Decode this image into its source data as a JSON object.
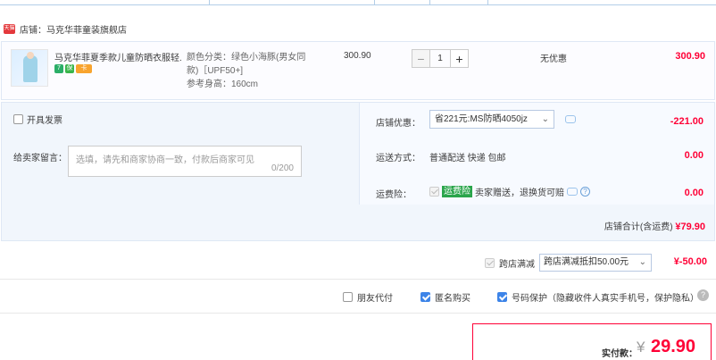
{
  "shop": {
    "badge": "天猫",
    "label": "店铺：",
    "name": "马克华菲童装旗舰店"
  },
  "item": {
    "title": "马克华菲夏季款儿童防晒衣服轻...",
    "badges": [
      "7",
      "保",
      "卡"
    ],
    "sku_color": "颜色分类：绿色小海豚(男女同款)［UPF50+]",
    "sku_height": "参考身高：160cm",
    "unit_price": "300.90",
    "quantity": "1",
    "qty_minus": "−",
    "qty_plus": "+",
    "discount": "无优惠",
    "total": "300.90"
  },
  "invoice": {
    "label": "开具发票"
  },
  "message": {
    "label": "给卖家留言：",
    "placeholder": "选填，请先和商家协商一致，付款后商家可见",
    "counter": "0/200"
  },
  "shop_coupon": {
    "label": "店铺优惠：",
    "selected": "省221元:MS防晒4050jz",
    "value": "-221.00"
  },
  "shipping": {
    "label": "运送方式：",
    "method": "普通配送 快递 包邮",
    "value": "0.00"
  },
  "insurance": {
    "label": "运费险：",
    "tag": "运费险",
    "text": "卖家赠送，退换货可赔",
    "value": "0.00"
  },
  "shop_total": {
    "label": "店铺合计(含运费)",
    "value": "¥79.90"
  },
  "cross_shop": {
    "label": "跨店满减",
    "selected": "跨店满减抵扣50.00元",
    "value": "¥-50.00"
  },
  "options": {
    "friend_pay": "朋友代付",
    "anonymous": "匿名购买",
    "number_protect": "号码保护（隐藏收件人真实手机号，保护隐私）",
    "help": "?"
  },
  "payment": {
    "label": "实付款：",
    "currency": "¥",
    "amount": "29.90"
  },
  "colors": {
    "accent_red": "#ff0036",
    "checkbox_blue": "#3d84e8",
    "panel_bg": "#f1f6fc"
  }
}
